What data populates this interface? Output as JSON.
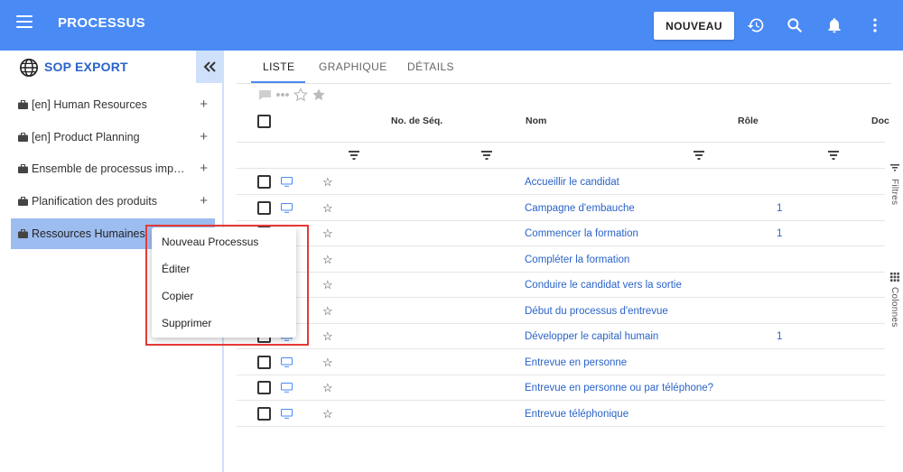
{
  "header": {
    "title": "PROCESSUS",
    "new_button": "NOUVEAU",
    "colors": {
      "bar": "#4a8af4"
    }
  },
  "sidebar": {
    "title": "SOP EXPORT",
    "items": [
      {
        "label": "[en] Human Resources"
      },
      {
        "label": "[en] Product Planning"
      },
      {
        "label": "Ensemble de processus impo…"
      },
      {
        "label": "Planification des produits"
      },
      {
        "label": "Ressources Humaines"
      }
    ]
  },
  "tabs": [
    {
      "label": "LISTE"
    },
    {
      "label": "GRAPHIQUE"
    },
    {
      "label": "DÉTAILS"
    }
  ],
  "table": {
    "columns": {
      "seq": "No. de Séq.",
      "name": "Nom",
      "role": "Rôle",
      "doc": "Doc"
    },
    "rows": [
      {
        "name": "Accueillir le candidat",
        "role": ""
      },
      {
        "name": "Campagne d'embauche",
        "role": "1"
      },
      {
        "name": "Commencer la formation",
        "role": "1"
      },
      {
        "name": "Compléter la formation",
        "role": ""
      },
      {
        "name": "Conduire le candidat vers la sortie",
        "role": ""
      },
      {
        "name": "Début du processus d'entrevue",
        "role": ""
      },
      {
        "name": "Développer le capital humain",
        "role": "1"
      },
      {
        "name": "Entrevue en personne",
        "role": ""
      },
      {
        "name": "Entrevue en personne ou par téléphone?",
        "role": ""
      },
      {
        "name": "Entrevue téléphonique",
        "role": ""
      }
    ]
  },
  "right_rail": {
    "filters": "Filtres",
    "columns": "Colonnes"
  },
  "context_menu": {
    "items": [
      {
        "label": "Nouveau Processus"
      },
      {
        "label": "Éditer"
      },
      {
        "label": "Copier"
      },
      {
        "label": "Supprimer"
      }
    ]
  }
}
